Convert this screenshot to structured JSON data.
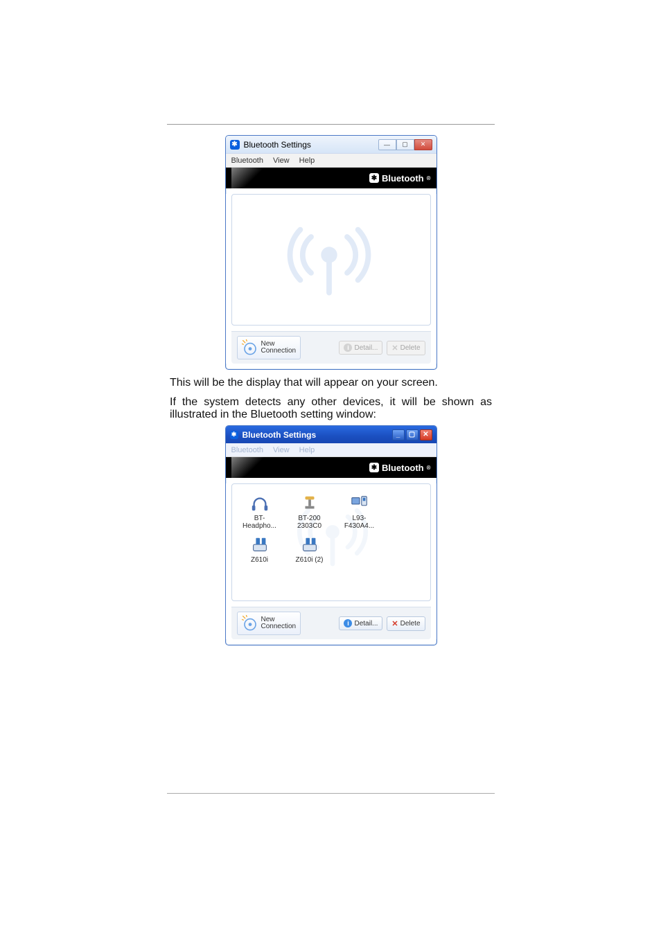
{
  "caption1": "This will be the display that will appear on your screen.",
  "caption2": "If the system detects any other devices, it will be shown as illustrated in the Bluetooth setting window:",
  "brand_label": "Bluetooth",
  "win1": {
    "title": "Bluetooth Settings",
    "menu": {
      "m1": "Bluetooth",
      "m2": "View",
      "m3": "Help"
    },
    "newconn": {
      "l1": "New",
      "l2": "Connection"
    },
    "detail_label": "Detail...",
    "delete_label": "Delete"
  },
  "win2": {
    "title": "Bluetooth Settings",
    "menu": {
      "m1": "Bluetooth",
      "m2": "View",
      "m3": "Help"
    },
    "devices": [
      {
        "name": "BT-Headpho..."
      },
      {
        "name": "BT-200 2303C0"
      },
      {
        "name": "L93-F430A4..."
      },
      {
        "name": "Z610i"
      },
      {
        "name": "Z610i (2)"
      }
    ],
    "newconn": {
      "l1": "New",
      "l2": "Connection"
    },
    "detail_label": "Detail...",
    "delete_label": "Delete"
  }
}
